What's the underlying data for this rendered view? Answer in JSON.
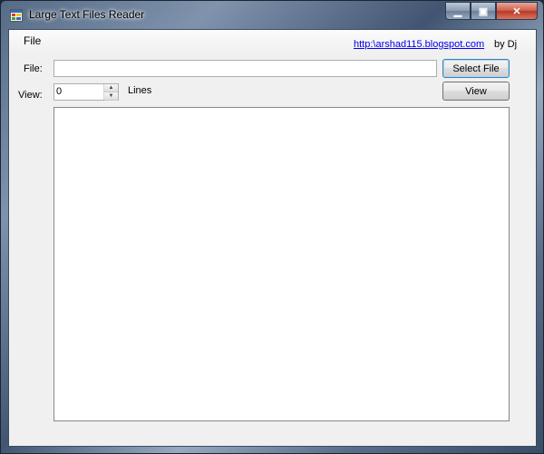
{
  "window": {
    "title": "Large Text Files Reader",
    "caption_buttons": {
      "minimize": "minimize-icon",
      "maximize": "maximize-icon",
      "close": "close-icon"
    }
  },
  "menubar": {
    "file_label": "File",
    "link_text": "http:\\arshad115.blogspot.com",
    "byline": "by Dj"
  },
  "form": {
    "file_label": "File:",
    "file_value": "",
    "select_file_label": "Select File",
    "view_label": "View:",
    "lines_value": "0",
    "lines_label": "Lines",
    "view_button_label": "View",
    "content_text": ""
  },
  "colors": {
    "link": "#0000ee",
    "client_bg": "#f0f0f0"
  }
}
